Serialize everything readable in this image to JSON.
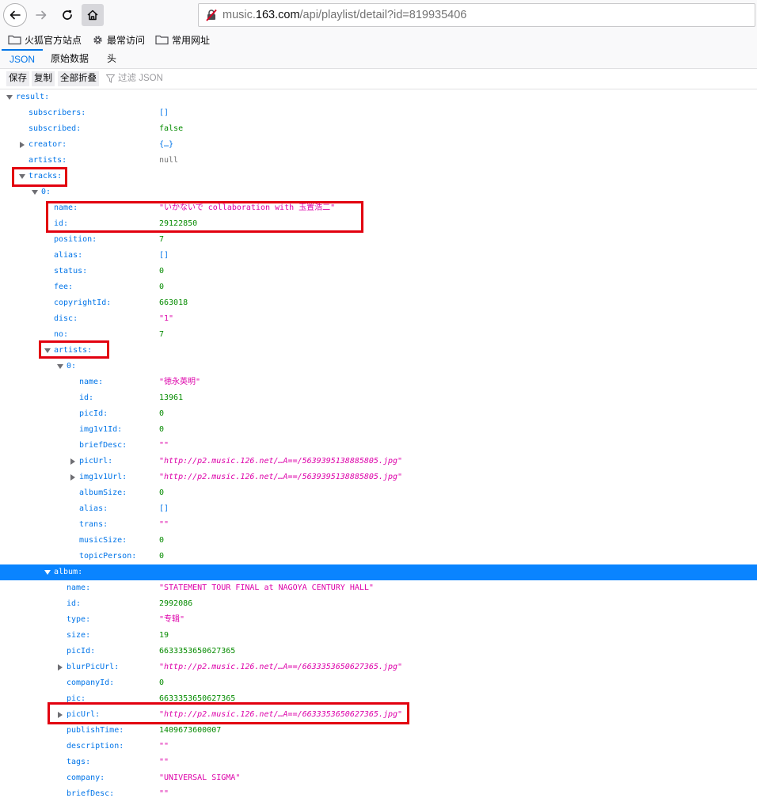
{
  "browser": {
    "url_prefix": "music.",
    "url_domain": "163.com",
    "url_suffix": "/api/playlist/detail?id=819935406"
  },
  "bookmarks": [
    {
      "label": "火狐官方站点",
      "icon": "folder-icon"
    },
    {
      "label": "最常访问",
      "icon": "gear-icon"
    },
    {
      "label": "常用网址",
      "icon": "folder-icon"
    }
  ],
  "tabs": [
    "JSON",
    "原始数据",
    "头"
  ],
  "toolbar": {
    "save": "保存",
    "copy": "复制",
    "collapse_all": "全部折叠",
    "filter_placeholder": "过滤 JSON"
  },
  "colors": {
    "key": "#0074e8",
    "string": "#dd00a9",
    "number": "#058b00",
    "null": "#737373",
    "selected_row": "#0a84ff",
    "highlight_box": "#e2000f"
  },
  "rows": [
    {
      "key": "result:",
      "value": "",
      "indent": 0,
      "tw": "exp",
      "type": ""
    },
    {
      "key": "subscribers:",
      "value": "[]",
      "indent": 1,
      "tw": "",
      "type": "arr"
    },
    {
      "key": "subscribed:",
      "value": "false",
      "indent": 1,
      "tw": "",
      "type": "bool"
    },
    {
      "key": "creator:",
      "value": "{…}",
      "indent": 1,
      "tw": "col",
      "type": "arr"
    },
    {
      "key": "artists:",
      "value": "null",
      "indent": 1,
      "tw": "",
      "type": "nul"
    },
    {
      "key": "tracks:",
      "value": "",
      "indent": 1,
      "tw": "exp",
      "type": ""
    },
    {
      "key": "0:",
      "value": "",
      "indent": 2,
      "tw": "exp",
      "type": ""
    },
    {
      "key": "name:",
      "value": "\"いかないで collaboration with 玉置浩二\"",
      "indent": 3,
      "tw": "",
      "type": "str"
    },
    {
      "key": "id:",
      "value": "29122850",
      "indent": 3,
      "tw": "",
      "type": "num"
    },
    {
      "key": "position:",
      "value": "7",
      "indent": 3,
      "tw": "",
      "type": "num"
    },
    {
      "key": "alias:",
      "value": "[]",
      "indent": 3,
      "tw": "",
      "type": "arr"
    },
    {
      "key": "status:",
      "value": "0",
      "indent": 3,
      "tw": "",
      "type": "num"
    },
    {
      "key": "fee:",
      "value": "0",
      "indent": 3,
      "tw": "",
      "type": "num"
    },
    {
      "key": "copyrightId:",
      "value": "663018",
      "indent": 3,
      "tw": "",
      "type": "num"
    },
    {
      "key": "disc:",
      "value": "\"1\"",
      "indent": 3,
      "tw": "",
      "type": "str"
    },
    {
      "key": "no:",
      "value": "7",
      "indent": 3,
      "tw": "",
      "type": "num"
    },
    {
      "key": "artists:",
      "value": "",
      "indent": 3,
      "tw": "exp",
      "type": ""
    },
    {
      "key": "0:",
      "value": "",
      "indent": 4,
      "tw": "exp",
      "type": ""
    },
    {
      "key": "name:",
      "value": "\"徳永英明\"",
      "indent": 5,
      "tw": "",
      "type": "str"
    },
    {
      "key": "id:",
      "value": "13961",
      "indent": 5,
      "tw": "",
      "type": "num"
    },
    {
      "key": "picId:",
      "value": "0",
      "indent": 5,
      "tw": "",
      "type": "num"
    },
    {
      "key": "img1v1Id:",
      "value": "0",
      "indent": 5,
      "tw": "",
      "type": "num"
    },
    {
      "key": "briefDesc:",
      "value": "\"\"",
      "indent": 5,
      "tw": "",
      "type": "str"
    },
    {
      "key": "picUrl:",
      "value": "\"http://p2.music.126.net/…A==/5639395138885805.jpg\"",
      "indent": 5,
      "tw": "col",
      "type": "url"
    },
    {
      "key": "img1v1Url:",
      "value": "\"http://p2.music.126.net/…A==/5639395138885805.jpg\"",
      "indent": 5,
      "tw": "col",
      "type": "url"
    },
    {
      "key": "albumSize:",
      "value": "0",
      "indent": 5,
      "tw": "",
      "type": "num"
    },
    {
      "key": "alias:",
      "value": "[]",
      "indent": 5,
      "tw": "",
      "type": "arr"
    },
    {
      "key": "trans:",
      "value": "\"\"",
      "indent": 5,
      "tw": "",
      "type": "str"
    },
    {
      "key": "musicSize:",
      "value": "0",
      "indent": 5,
      "tw": "",
      "type": "num"
    },
    {
      "key": "topicPerson:",
      "value": "0",
      "indent": 5,
      "tw": "",
      "type": "num"
    },
    {
      "key": "album:",
      "value": "",
      "indent": 3,
      "tw": "exp",
      "type": "",
      "selected": true
    },
    {
      "key": "name:",
      "value": "\"STATEMENT TOUR FINAL at NAGOYA CENTURY HALL\"",
      "indent": 4,
      "tw": "",
      "type": "str"
    },
    {
      "key": "id:",
      "value": "2992086",
      "indent": 4,
      "tw": "",
      "type": "num"
    },
    {
      "key": "type:",
      "value": "\"专辑\"",
      "indent": 4,
      "tw": "",
      "type": "str"
    },
    {
      "key": "size:",
      "value": "19",
      "indent": 4,
      "tw": "",
      "type": "num"
    },
    {
      "key": "picId:",
      "value": "6633353650627365",
      "indent": 4,
      "tw": "",
      "type": "num"
    },
    {
      "key": "blurPicUrl:",
      "value": "\"http://p2.music.126.net/…A==/6633353650627365.jpg\"",
      "indent": 4,
      "tw": "col",
      "type": "url"
    },
    {
      "key": "companyId:",
      "value": "0",
      "indent": 4,
      "tw": "",
      "type": "num"
    },
    {
      "key": "pic:",
      "value": "6633353650627365",
      "indent": 4,
      "tw": "",
      "type": "num"
    },
    {
      "key": "picUrl:",
      "value": "\"http://p2.music.126.net/…A==/6633353650627365.jpg\"",
      "indent": 4,
      "tw": "col",
      "type": "url"
    },
    {
      "key": "publishTime:",
      "value": "1409673600007",
      "indent": 4,
      "tw": "",
      "type": "num"
    },
    {
      "key": "description:",
      "value": "\"\"",
      "indent": 4,
      "tw": "",
      "type": "str"
    },
    {
      "key": "tags:",
      "value": "\"\"",
      "indent": 4,
      "tw": "",
      "type": "str"
    },
    {
      "key": "company:",
      "value": "\"UNIVERSAL SIGMA\"",
      "indent": 4,
      "tw": "",
      "type": "str"
    },
    {
      "key": "briefDesc:",
      "value": "\"\"",
      "indent": 4,
      "tw": "",
      "type": "str"
    }
  ]
}
